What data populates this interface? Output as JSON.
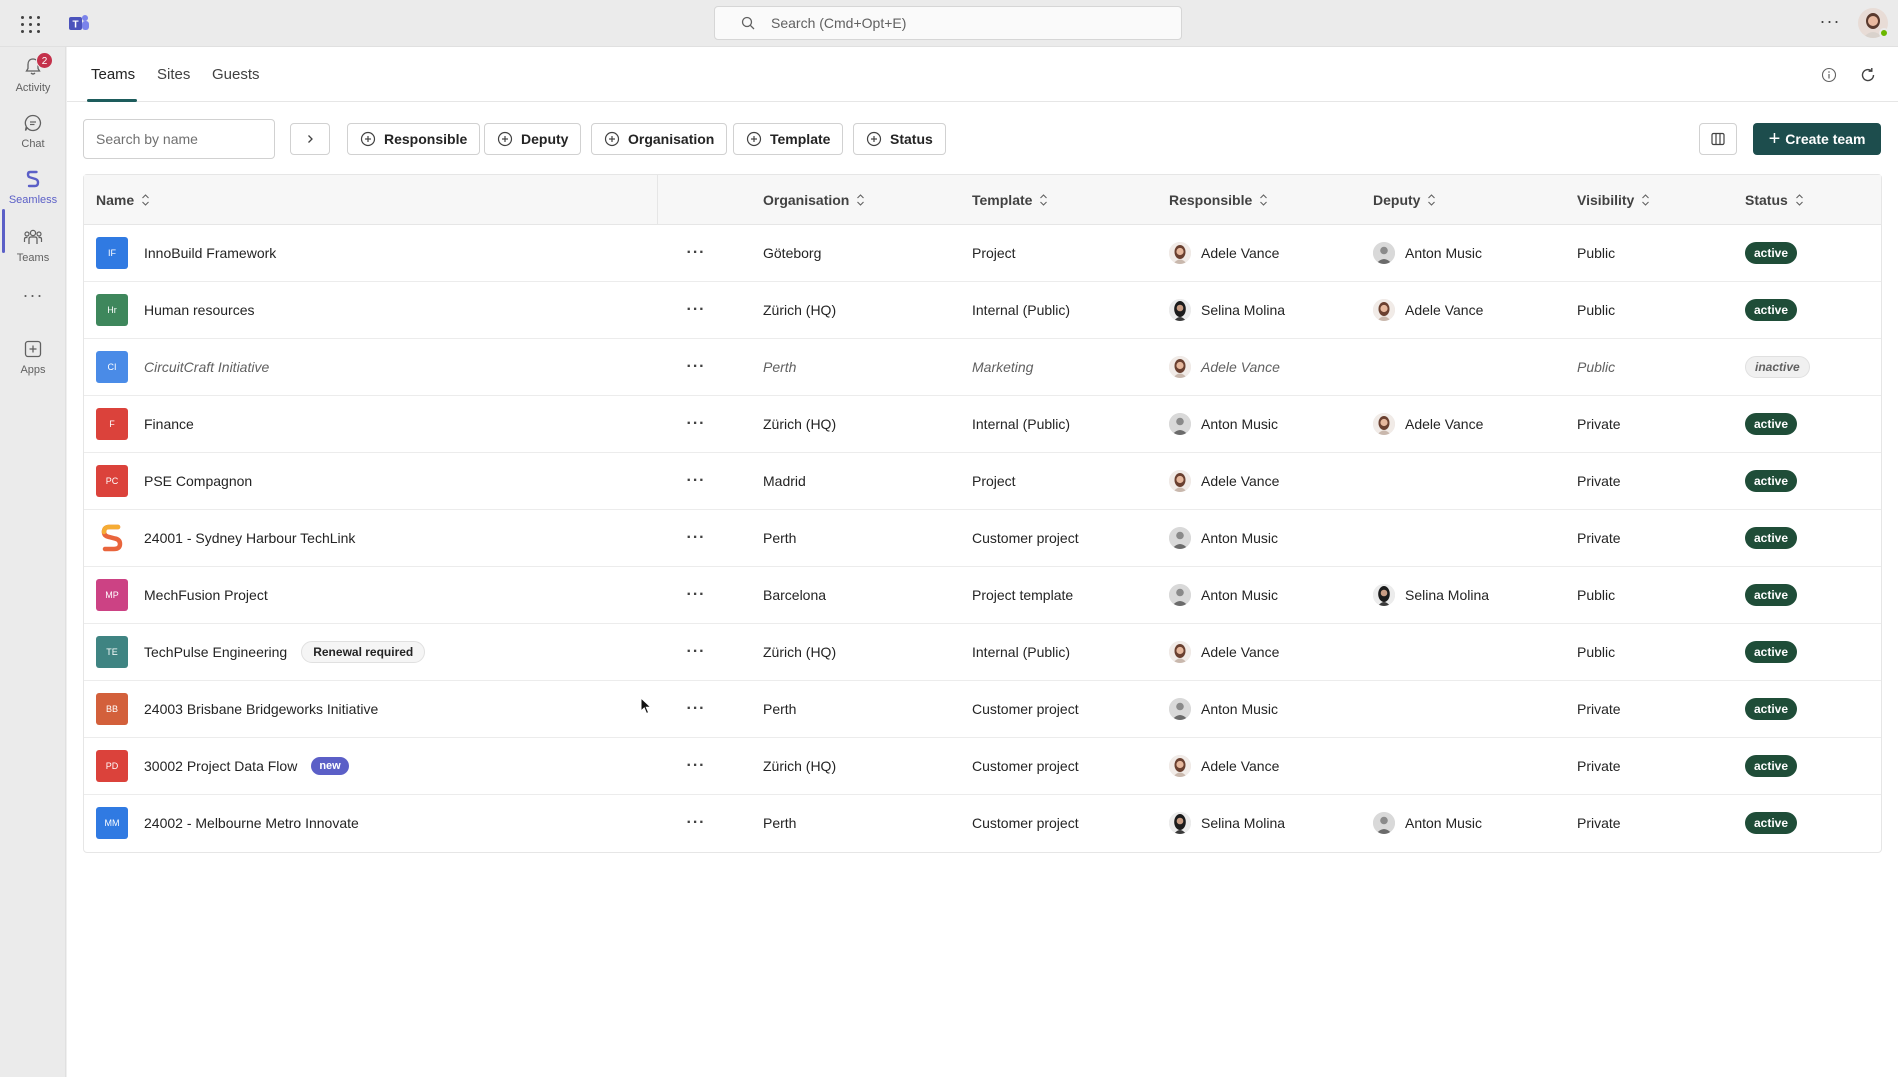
{
  "topbar": {
    "search_placeholder": "Search (Cmd+Opt+E)"
  },
  "rail": {
    "items": [
      {
        "label": "Activity",
        "icon": "bell-icon",
        "badge": "2"
      },
      {
        "label": "Chat",
        "icon": "chat-icon"
      },
      {
        "label": "Seamless",
        "icon": "seamless-icon"
      },
      {
        "label": "Teams",
        "icon": "teams-icon"
      },
      {
        "label": "Apps",
        "icon": "apps-icon"
      }
    ]
  },
  "tabs": [
    {
      "label": "Teams",
      "active": true
    },
    {
      "label": "Sites"
    },
    {
      "label": "Guests"
    }
  ],
  "toolbar": {
    "search_placeholder": "Search by name",
    "filters": [
      "Responsible",
      "Deputy",
      "Organisation",
      "Template",
      "Status"
    ],
    "create_label": "Create team"
  },
  "table": {
    "headers": {
      "name": "Name",
      "organisation": "Organisation",
      "template": "Template",
      "responsible": "Responsible",
      "deputy": "Deputy",
      "visibility": "Visibility",
      "status": "Status"
    },
    "rows": [
      {
        "initials": "IF",
        "color": "#1f6fe0",
        "name": "InnoBuild Framework",
        "org": "Göteborg",
        "template": "Project",
        "responsible": "Adele Vance",
        "deputy": "Anton Music",
        "visibility": "Public",
        "status": "active"
      },
      {
        "initials": "Hr",
        "color": "#2e7d4f",
        "name": "Human resources",
        "org": "Zürich (HQ)",
        "template": "Internal (Public)",
        "responsible": "Selina Molina",
        "deputy": "Adele Vance",
        "visibility": "Public",
        "status": "active"
      },
      {
        "initials": "CI",
        "color": "#3b82e6",
        "name": "CircuitCraft Initiative",
        "org": "Perth",
        "template": "Marketing",
        "responsible": "Adele Vance",
        "deputy": "",
        "visibility": "Public",
        "status": "inactive"
      },
      {
        "initials": "F",
        "color": "#d8322b",
        "name": "Finance",
        "org": "Zürich (HQ)",
        "template": "Internal (Public)",
        "responsible": "Anton Music",
        "deputy": "Adele Vance",
        "visibility": "Private",
        "status": "active"
      },
      {
        "initials": "PC",
        "color": "#d8322b",
        "name": "PSE Compagnon",
        "org": "Madrid",
        "template": "Project",
        "responsible": "Adele Vance",
        "deputy": "",
        "visibility": "Private",
        "status": "active"
      },
      {
        "initials": "S",
        "color": "logo",
        "name": "24001 - Sydney Harbour TechLink",
        "org": "Perth",
        "template": "Customer project",
        "responsible": "Anton Music",
        "deputy": "",
        "visibility": "Private",
        "status": "active"
      },
      {
        "initials": "MP",
        "color": "#c8327a",
        "name": "MechFusion Project",
        "org": "Barcelona",
        "template": "Project template",
        "responsible": "Anton Music",
        "deputy": "Selina Molina",
        "visibility": "Public",
        "status": "active"
      },
      {
        "initials": "TE",
        "color": "#2f7a78",
        "name": "TechPulse Engineering",
        "chip": "Renewal required",
        "org": "Zürich (HQ)",
        "template": "Internal (Public)",
        "responsible": "Adele Vance",
        "deputy": "",
        "visibility": "Public",
        "status": "active"
      },
      {
        "initials": "BB",
        "color": "#d0532b",
        "name": "24003 Brisbane Bridgeworks Initiative",
        "org": "Perth",
        "template": "Customer project",
        "responsible": "Anton Music",
        "deputy": "",
        "visibility": "Private",
        "status": "active"
      },
      {
        "initials": "PD",
        "color": "#d8322b",
        "name": "30002 Project Data Flow",
        "new_chip": "new",
        "org": "Zürich (HQ)",
        "template": "Customer project",
        "responsible": "Adele Vance",
        "deputy": "",
        "visibility": "Private",
        "status": "active"
      },
      {
        "initials": "MM",
        "color": "#1f6fe0",
        "name": "24002 - Melbourne Metro Innovate",
        "org": "Perth",
        "template": "Customer project",
        "responsible": "Selina Molina",
        "deputy": "Anton Music",
        "visibility": "Private",
        "status": "active"
      }
    ]
  },
  "colors": {
    "accent": "#5b5fc7",
    "primary_button": "#1d4d4d",
    "active_status": "#1f4d38",
    "notification_badge": "#c4314b"
  }
}
